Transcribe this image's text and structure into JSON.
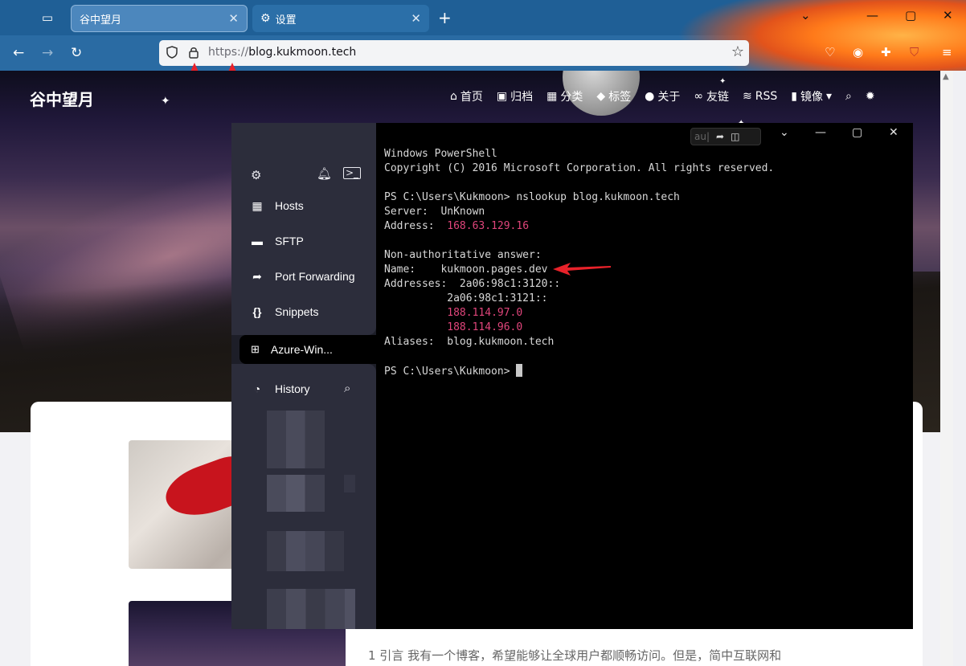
{
  "browser": {
    "tabs": [
      {
        "label": "谷中望月",
        "active": true
      },
      {
        "label": "设置",
        "active": false
      }
    ],
    "url_protocol": "https://",
    "url_host": "blog.kukmoon.tech",
    "colors": {
      "tabbar": "#1f5f96",
      "navbar": "#2a6ba3",
      "arrow": "#e8222a"
    }
  },
  "site": {
    "brand": "谷中望月",
    "nav": [
      {
        "icon": "home-icon",
        "label": "首页"
      },
      {
        "icon": "archive-icon",
        "label": "归档"
      },
      {
        "icon": "grid-icon",
        "label": "分类"
      },
      {
        "icon": "tag-icon",
        "label": "标签"
      },
      {
        "icon": "user-icon",
        "label": "关于"
      },
      {
        "icon": "link-icon",
        "label": "友链"
      },
      {
        "icon": "rss-icon",
        "label": "RSS"
      },
      {
        "icon": "file-icon",
        "label": "镜像"
      }
    ],
    "excerpt": "1 引言 我有一个博客，希望能够让全球用户都顺畅访问。但是，简中互联网和"
  },
  "terminal_app": {
    "sidebar": {
      "items": [
        {
          "icon": "hosts-icon",
          "label": "Hosts"
        },
        {
          "icon": "folder-icon",
          "label": "SFTP"
        },
        {
          "icon": "port-forwarding-icon",
          "label": "Port Forwarding"
        },
        {
          "icon": "braces-icon",
          "label": "Snippets"
        }
      ],
      "active_session": "Azure-Win...",
      "history_label": "History"
    },
    "toolbar_chip": "au|",
    "lines": {
      "l1": "Windows PowerShell",
      "l2": "Copyright (C) 2016 Microsoft Corporation. All rights reserved.",
      "l3": "PS C:\\Users\\Kukmoon> nslookup blog.kukmoon.tech",
      "l4": "Server:  UnKnown",
      "l5_label": "Address:  ",
      "l5_value": "168.63.129.16",
      "l6": "Non-authoritative answer:",
      "l7": "Name:    kukmoon.pages.dev",
      "l8": "Addresses:  2a06:98c1:3120::",
      "l9": "          2a06:98c1:3121::",
      "l10": "188.114.97.0",
      "l11": "188.114.96.0",
      "l12": "Aliases:  blog.kukmoon.tech",
      "l13": "PS C:\\Users\\Kukmoon> "
    }
  }
}
